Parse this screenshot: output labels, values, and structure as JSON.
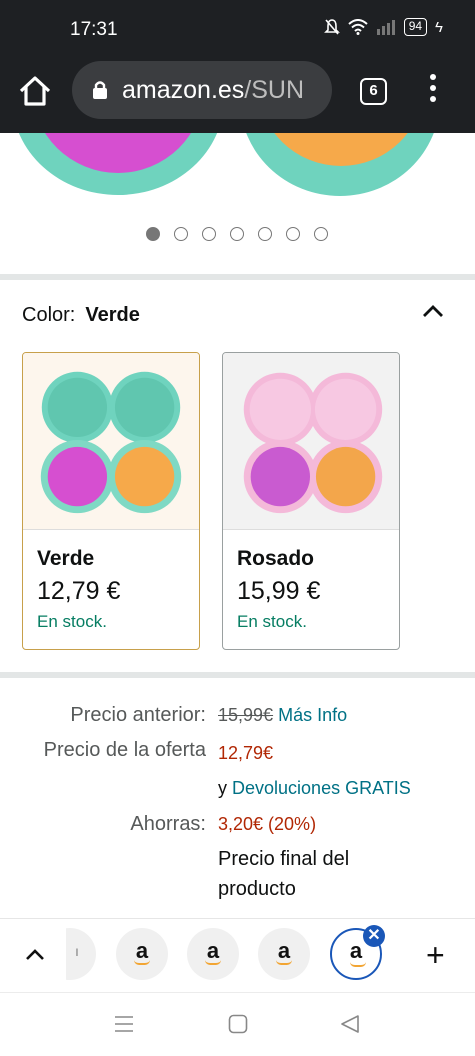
{
  "status_bar": {
    "time": "17:31",
    "battery": "94"
  },
  "browser": {
    "url_host": "amazon.es",
    "url_path": "/SUN",
    "tab_count": "6"
  },
  "gallery": {
    "image_count": 7,
    "active_index": 0
  },
  "color_selector": {
    "label": "Color:",
    "selected": "Verde",
    "options": [
      {
        "name": "Verde",
        "price": "12,79 €",
        "stock": "En stock."
      },
      {
        "name": "Rosado",
        "price": "15,99 €",
        "stock": "En stock."
      }
    ]
  },
  "pricing": {
    "previous_label": "Precio anterior:",
    "previous_value": "15,99€",
    "more_info": "Más Info",
    "deal_label": "Precio de la oferta",
    "deal_value": "12,79€",
    "returns_prefix": "y",
    "returns_link": "Devoluciones GRATIS",
    "savings_label": "Ahorras:",
    "savings_value": "3,20€ (20%)",
    "final_note_line1": "Precio final del",
    "final_note_line2": "producto"
  },
  "tab_strip": {
    "tab_letter": "a",
    "close_glyph": "✕",
    "add_glyph": "+"
  },
  "colors": {
    "teal": "#6fd3be",
    "pink": "#f4b9d9",
    "magenta": "#d64fd0",
    "orange": "#f6a94a",
    "deal_red": "#b12704",
    "link_teal": "#007185",
    "stock_green": "#067d62"
  }
}
